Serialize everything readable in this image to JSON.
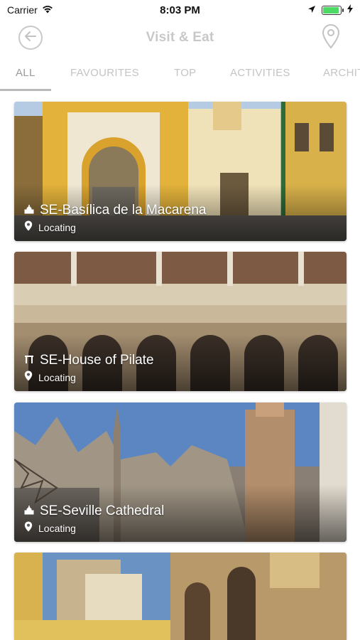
{
  "status_bar": {
    "carrier": "Carrier",
    "time": "8:03 PM",
    "battery_level": 0.9
  },
  "nav": {
    "title": "Visit & Eat",
    "back_icon": "back-arrow-circle-icon",
    "map_icon": "map-pin-icon"
  },
  "tabs": [
    {
      "label": "ALL",
      "active": true
    },
    {
      "label": "FAVOURITES",
      "active": false
    },
    {
      "label": "TOP",
      "active": false
    },
    {
      "label": "ACTIVITIES",
      "active": false
    },
    {
      "label": "ARCHITECTURE",
      "active": false
    }
  ],
  "cards": [
    {
      "title": "SE-Basílica de la Macarena",
      "subtitle": "Locating",
      "category_icon": "church-icon"
    },
    {
      "title": "SE-House of Pilate",
      "subtitle": "Locating",
      "category_icon": "landmark-icon"
    },
    {
      "title": "SE-Seville Cathedral",
      "subtitle": "Locating",
      "category_icon": "church-icon"
    },
    {
      "title": "",
      "subtitle": "",
      "category_icon": ""
    }
  ],
  "colors": {
    "nav_title": "#c8c8c8",
    "tab_inactive": "#c4c4c4",
    "tab_active": "#9a9a9a",
    "battery": "#4cd964"
  }
}
